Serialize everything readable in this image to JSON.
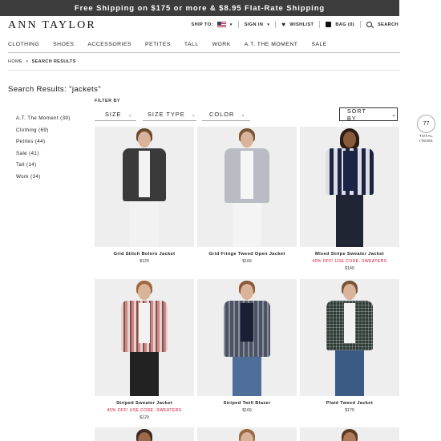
{
  "promo_bar": "Free Shipping on $175 or more & $8.95 Flat-Rate Shipping",
  "logo": "ANN TAYLOR",
  "utility": {
    "ship_to": "SHIP TO:",
    "sign_in": "SIGN IN",
    "wishlist": "WISHLIST",
    "bag": "BAG (0)",
    "search": "SEARCH"
  },
  "nav": [
    "CLOTHING",
    "SHOES",
    "ACCESSORIES",
    "PETITES",
    "TALL",
    "WORK",
    "A.T. THE MOMENT",
    "SALE"
  ],
  "breadcrumb": {
    "home": "HOME",
    "sep": ">",
    "current": "SEARCH RESULTS"
  },
  "results_title": "Search Results: \"jackets\"",
  "filter_by": "FILTER BY",
  "facets": [
    "A.T. The Moment (39)",
    "Clothing (69)",
    "Petites (44)",
    "Sale (41)",
    "Tall (14)",
    "Work (34)"
  ],
  "filters": {
    "size": "SIZE",
    "size_type": "SIZE TYPE",
    "color": "COLOR"
  },
  "sort_by": "SORT BY",
  "total": {
    "count": "77",
    "label_1": "TOTAL",
    "label_2": "ITEMS"
  },
  "products": [
    {
      "name": "Grid Stitch Bolero Jacket",
      "promo": "",
      "price": "$129",
      "jacket_color": "#3a3a3a",
      "pants_color": "#f2f2f2"
    },
    {
      "name": "Grid Fringe Tweed Open Jacket",
      "promo": "",
      "price": "$169",
      "jacket_color": "#b9bcc4",
      "pants_color": "#f4f4f4"
    },
    {
      "name": "Mixed Stripe Sweater Jacket",
      "promo": "40% OFF! USE CODE: SWEATERS",
      "price": "$149",
      "jacket_color": "#1d2344",
      "pants_color": "#1f2535"
    },
    {
      "name": "Striped Sweater Jacket",
      "promo": "40% OFF! USE CODE: SWEATERS",
      "price": "$129",
      "jacket_color": "#c98a86",
      "pants_color": "#222222"
    },
    {
      "name": "Striped Twill Blazer",
      "promo": "",
      "price": "$169",
      "jacket_color": "#4a5264",
      "pants_color": "#4f6f9a"
    },
    {
      "name": "Plaid Tweed Jacket",
      "promo": "",
      "price": "$179",
      "jacket_color": "#2f3b35",
      "pants_color": "#3c5a86"
    }
  ]
}
